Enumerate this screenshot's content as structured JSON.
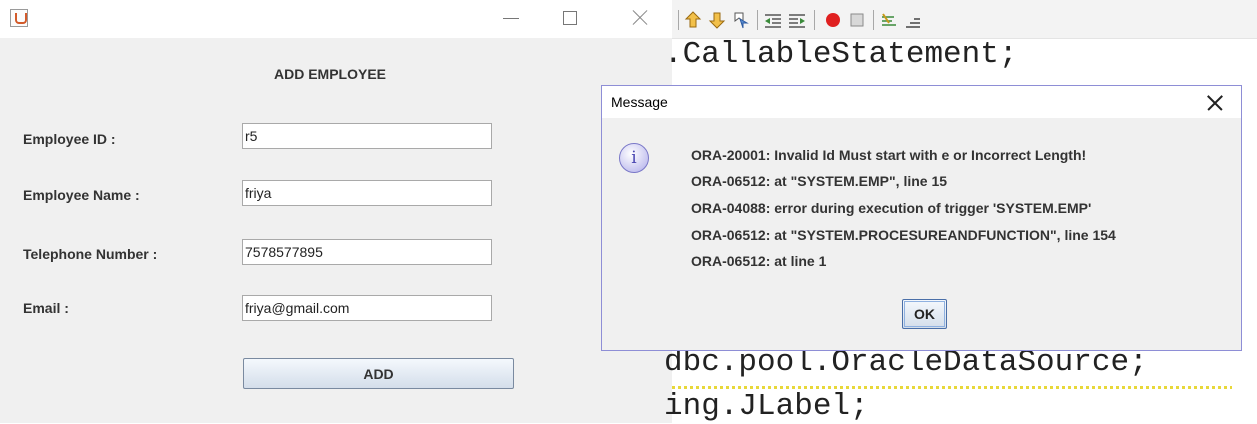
{
  "form": {
    "heading": "ADD EMPLOYEE",
    "fields": [
      {
        "label": "Employee ID :",
        "value": "r5"
      },
      {
        "label": "Employee Name :",
        "value": "friya"
      },
      {
        "label": "Telephone Number :",
        "value": "7578577895"
      },
      {
        "label": "Email :",
        "value": "friya@gmail.com"
      }
    ],
    "add_label": "ADD"
  },
  "editor": {
    "lines": [
      ".CallableStatement;",
      "dbc.pool.OracleDataSource;",
      "ing.JLabel;"
    ]
  },
  "dialog": {
    "title": "Message",
    "icon": "info-icon",
    "messages": [
      "ORA-20001: Invalid Id Must start with e or Incorrect Length!",
      "ORA-06512: at \"SYSTEM.EMP\", line 15",
      "ORA-04088: error during execution of trigger 'SYSTEM.EMP'",
      "ORA-06512: at \"SYSTEM.PROCESUREANDFUNCTION\", line 154",
      "ORA-06512: at line 1"
    ],
    "ok_label": "OK"
  },
  "colors": {
    "dialog_border": "#8e8ed6",
    "record_red": "#e02020"
  }
}
